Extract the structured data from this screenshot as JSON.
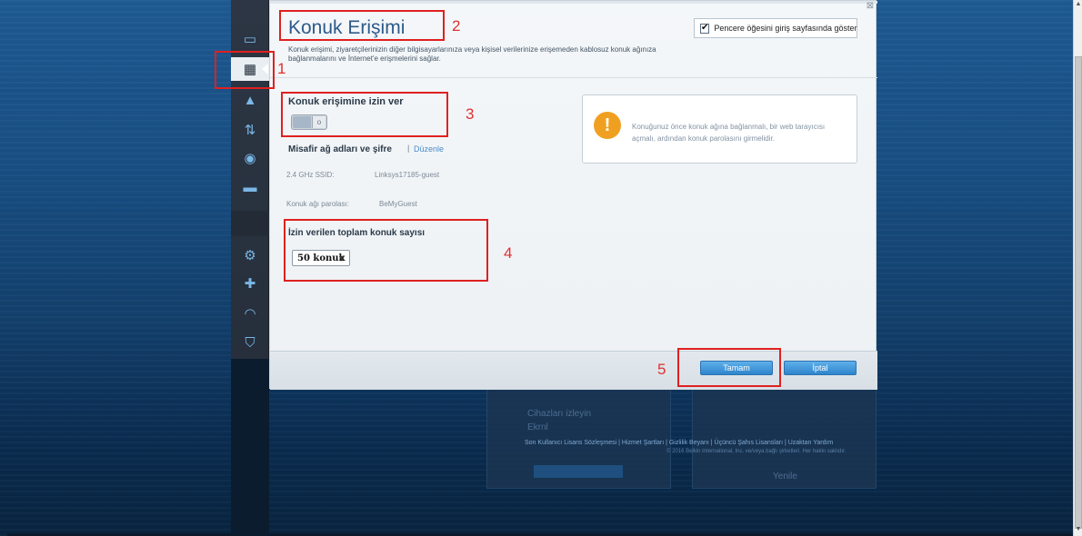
{
  "modal": {
    "title": "Konuk Erişimi",
    "description": "Konuk erişimi, ziyaretçilerinizin diğer bilgisayarlarınıza veya kişisel verilerinize erişemeden kablosuz konuk ağınıza bağlanmalarını ve İnternet'e erişmelerini sağlar.",
    "show_on_login_label": "Pencere öğesini giriş sayfasında göster",
    "show_on_login_checked": true,
    "close_glyph": "⊠",
    "allow_guest_label": "Konuk erişimine izin ver",
    "allow_guest_enabled": false,
    "guest_names_label": "Misafir ağ adları ve şifre",
    "separator": "|",
    "edit_link": "Düzenle",
    "ssid_key": "2.4 GHz SSID:",
    "ssid_value": "Linksys17185-guest",
    "password_key": "Konuk ağı parolası:",
    "password_value": "BeMyGuest",
    "max_guests_label": "İzin verilen toplam konuk sayısı",
    "max_guests_value": "50 konuk",
    "warning_text": "Konuğunuz önce konuk ağına bağlanmalı, bir web tarayıcısı açmalı, ardından konuk parolasını girmelidir.",
    "ok_button": "Tamam",
    "cancel_button": "İptal"
  },
  "sidebar": {
    "items": [
      {
        "icon": "devices-icon",
        "glyph": "▭"
      },
      {
        "icon": "guest-access-icon",
        "glyph": "▦",
        "active": true
      },
      {
        "icon": "alert-icon",
        "glyph": "▲"
      },
      {
        "icon": "priority-icon",
        "glyph": "⇅"
      },
      {
        "icon": "speed-test-icon",
        "glyph": "◉"
      },
      {
        "icon": "storage-icon",
        "glyph": "▬"
      },
      {
        "icon": "settings-icon",
        "glyph": "⚙"
      },
      {
        "icon": "troubleshoot-icon",
        "glyph": "✚"
      },
      {
        "icon": "wireless-icon",
        "glyph": "◠"
      },
      {
        "icon": "security-icon",
        "glyph": "⛉"
      }
    ]
  },
  "background": {
    "card_text_1": "Cihazları izleyin",
    "card_text_2": "Ekrnl",
    "footer_links": "Son Kullanıcı Lisans Sözleşmesi | Hizmet Şartları | Gizlilik Beyanı | Üçüncü Şahıs Lisansları | Uzaktan Yardım",
    "copyright": "© 2016 Belkin International, Inc. ve/veya bağlı şirketleri. Her hakkı saklıdır.",
    "card_btn_text": "Yenile"
  },
  "annotations": [
    "1",
    "2",
    "3",
    "4",
    "5"
  ],
  "colors": {
    "annotation": "#e02020",
    "title": "#2d5a8a",
    "button": "#2f85cc",
    "warning": "#f0a020"
  }
}
